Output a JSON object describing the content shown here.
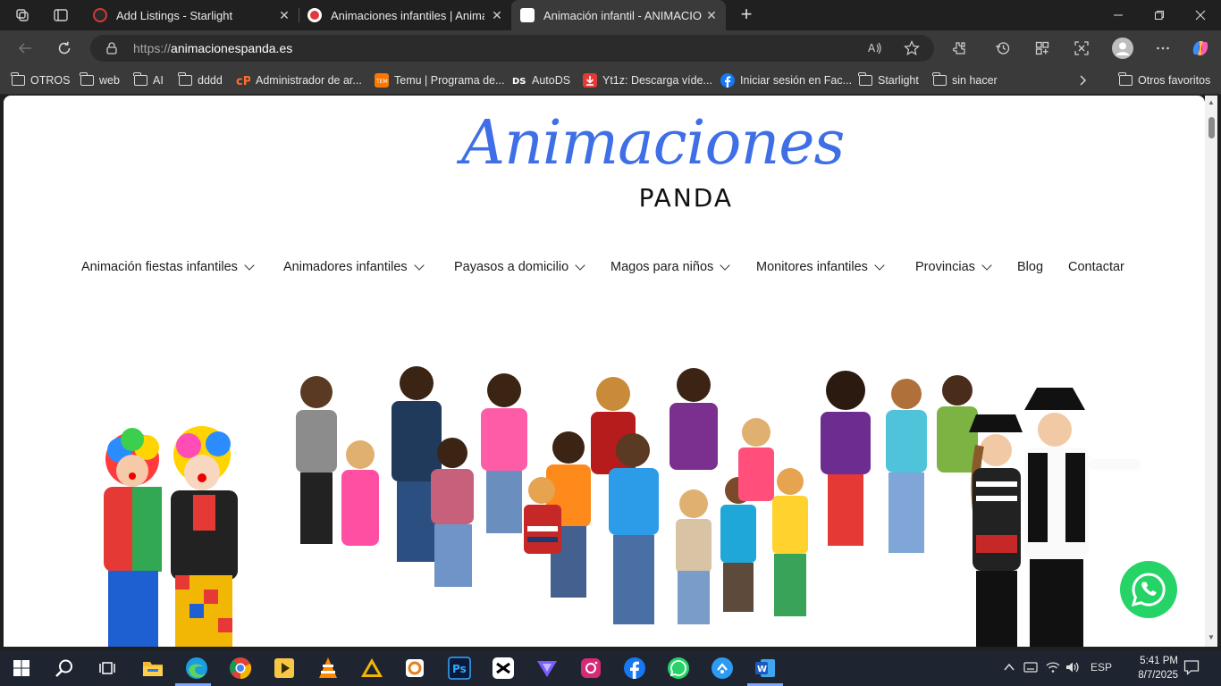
{
  "browser": {
    "tabs": [
      {
        "title": "Add Listings - Starlight",
        "favicon_color": "#d23a3a"
      },
      {
        "title": "Animaciones infantiles | Animadores",
        "favicon_color": "#e23a3a"
      },
      {
        "title": "Animación infantil - ANIMACIONES PANDA",
        "favicon_color": "#ffffff"
      }
    ],
    "url_scheme": "https://",
    "url_host": "animacionespanda.es",
    "bookmarks": [
      {
        "label": "OTROS",
        "icon": "folder-icon"
      },
      {
        "label": "web",
        "icon": "folder-icon"
      },
      {
        "label": "AI",
        "icon": "folder-icon"
      },
      {
        "label": "dddd",
        "icon": "folder-icon"
      },
      {
        "label": "Administrador de ar...",
        "icon": "cpanel-icon"
      },
      {
        "label": "Temu | Programa de...",
        "icon": "temu-icon"
      },
      {
        "label": "AutoDS",
        "icon": "autods-icon"
      },
      {
        "label": "Yt1z: Descarga víde...",
        "icon": "download-icon"
      },
      {
        "label": "Iniciar sesión en Fac...",
        "icon": "facebook-icon"
      },
      {
        "label": "Starlight",
        "icon": "folder-icon"
      },
      {
        "label": "sin hacer",
        "icon": "folder-icon"
      }
    ],
    "other_bookmarks": "Otros favoritos"
  },
  "site": {
    "logo_script": "Animaciones",
    "logo_sub": "PANDA",
    "nav": [
      {
        "label": "Animación fiestas infantiles",
        "has_dropdown": true
      },
      {
        "label": "Animadores infantiles",
        "has_dropdown": true
      },
      {
        "label": "Payasos a domicilio",
        "has_dropdown": true
      },
      {
        "label": "Magos para niños",
        "has_dropdown": true
      },
      {
        "label": "Monitores infantiles",
        "has_dropdown": true
      },
      {
        "label": "Provincias",
        "has_dropdown": true
      },
      {
        "label": "Blog",
        "has_dropdown": false
      },
      {
        "label": "Contactar",
        "has_dropdown": false
      }
    ],
    "accent_color": "#3f6fe6",
    "whatsapp_color": "#25d366"
  },
  "taskbar": {
    "language": "ESP",
    "time": "5:41 PM",
    "date": "8/7/2025"
  }
}
